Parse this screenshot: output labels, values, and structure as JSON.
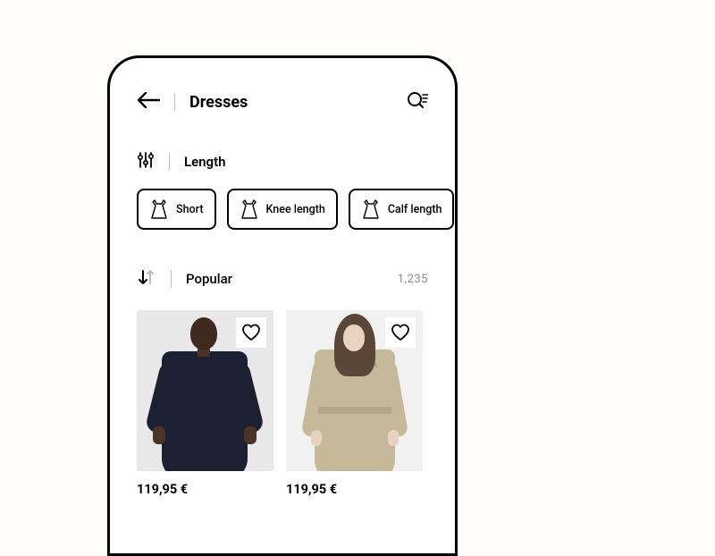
{
  "header": {
    "title": "Dresses"
  },
  "filter": {
    "group_label": "Length",
    "chips": [
      {
        "label": "Short"
      },
      {
        "label": "Knee length"
      },
      {
        "label": "Calf length"
      },
      {
        "label": ""
      }
    ]
  },
  "sort": {
    "label": "Popular",
    "count": "1,235"
  },
  "products": [
    {
      "price": "119,95 €"
    },
    {
      "price": "119,95 €"
    }
  ]
}
